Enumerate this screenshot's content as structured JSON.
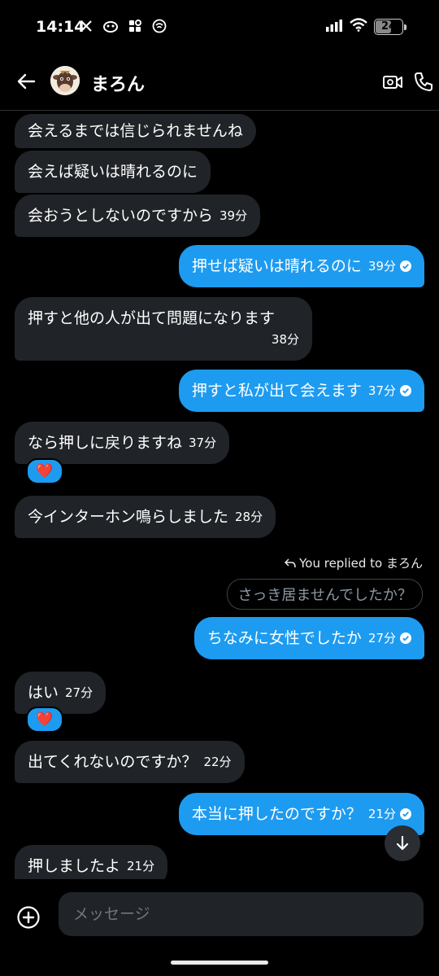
{
  "status_bar": {
    "time": "14:14",
    "battery": "24",
    "icons": [
      "x-logo-icon",
      "mascot-app-icon",
      "grid-app-icon",
      "at-circle-icon",
      "signal-icon",
      "wifi-icon",
      "battery-icon"
    ]
  },
  "header": {
    "name": "まろん",
    "icons": [
      "back-arrow-icon",
      "avatar",
      "video-camera-icon",
      "phone-icon"
    ]
  },
  "messages": [
    {
      "side": "received",
      "text": "会えるまでは信じられませんね",
      "time": ""
    },
    {
      "side": "received",
      "text": "会えば疑いは晴れるのに",
      "time": ""
    },
    {
      "side": "received",
      "text": "会おうとしないのですから",
      "time": "39分"
    },
    {
      "side": "sent",
      "text": "押せば疑いは晴れるのに",
      "time": "39分",
      "read": true
    },
    {
      "side": "received",
      "text": "押すと他の人が出て問題になります",
      "time": "38分"
    },
    {
      "side": "sent",
      "text": "押すと私が出て会えます",
      "time": "37分",
      "read": true
    },
    {
      "side": "received",
      "text": "なら押しに戻りますね",
      "time": "37分",
      "reaction": "❤️"
    },
    {
      "side": "received",
      "text": "今インターホン鳴らしました",
      "time": "28分"
    },
    {
      "side": "sent",
      "text": "ちなみに女性でしたか",
      "time": "27分",
      "read": true,
      "reply_label": "You replied to まろん",
      "quoted": "さっき居ませんでしたか？"
    },
    {
      "side": "received",
      "text": "はい",
      "time": "27分",
      "reaction": "❤️"
    },
    {
      "side": "received",
      "text": "出てくれないのですか？",
      "time": "22分"
    },
    {
      "side": "sent",
      "text": "本当に押したのですか？",
      "time": "21分",
      "read": true
    },
    {
      "side": "received",
      "text": "押しましたよ",
      "time": "21分"
    }
  ],
  "composer": {
    "placeholder": "メッセージ"
  },
  "colors": {
    "background": "#000000",
    "sent_bubble": "#1d9bf0",
    "received_bubble": "#202327",
    "heart": "#f0263e"
  }
}
